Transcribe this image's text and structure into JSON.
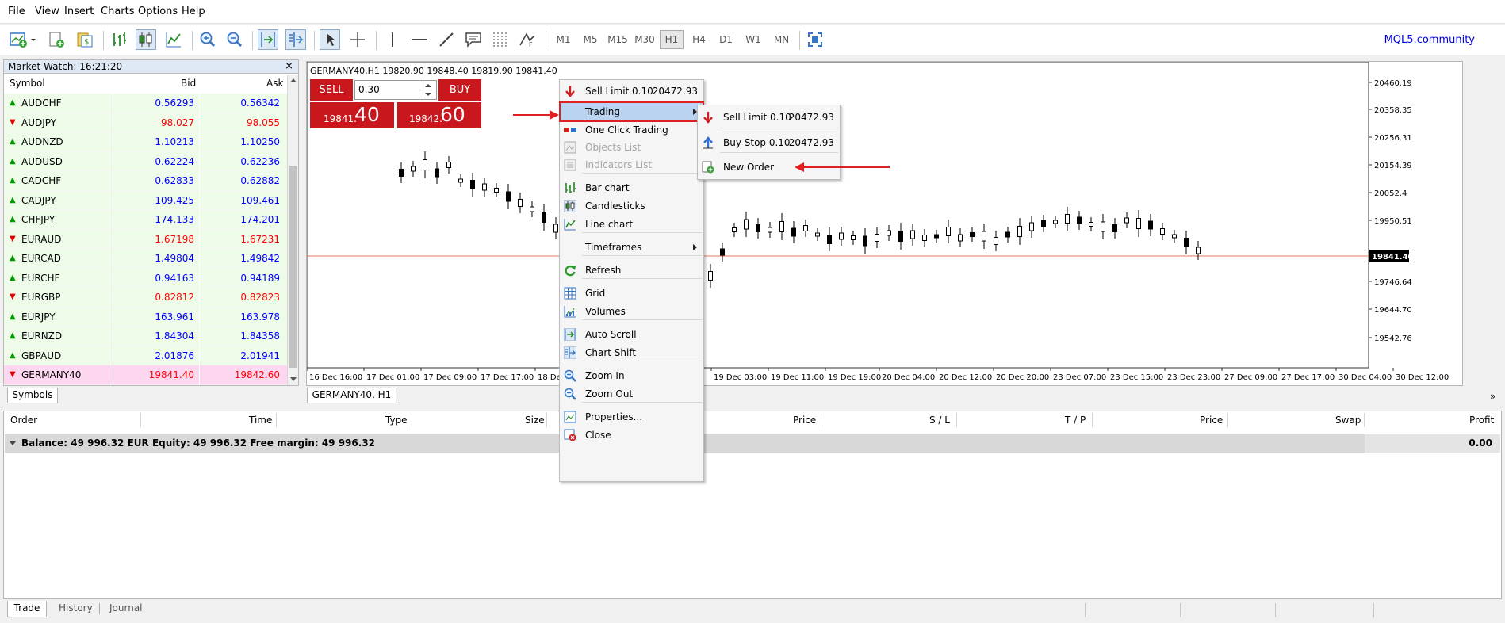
{
  "menubar": [
    "File",
    "View",
    "Insert",
    "Charts",
    "Options",
    "Help"
  ],
  "toolbar": {
    "timeframes": [
      "M1",
      "M5",
      "M15",
      "M30",
      "H1",
      "H4",
      "D1",
      "W1",
      "MN"
    ],
    "active_timeframe": "H1",
    "community_link": "MQL5.community"
  },
  "market_watch": {
    "title": "Market Watch: 16:21:20",
    "close": "×",
    "columns": [
      "Symbol",
      "Bid",
      "Ask"
    ],
    "rows": [
      {
        "symbol": "AUDCHF",
        "bid": "0.56293",
        "ask": "0.56342",
        "dir": "up"
      },
      {
        "symbol": "AUDJPY",
        "bid": "98.027",
        "ask": "98.055",
        "dir": "down"
      },
      {
        "symbol": "AUDNZD",
        "bid": "1.10213",
        "ask": "1.10250",
        "dir": "up"
      },
      {
        "symbol": "AUDUSD",
        "bid": "0.62224",
        "ask": "0.62236",
        "dir": "up"
      },
      {
        "symbol": "CADCHF",
        "bid": "0.62833",
        "ask": "0.62882",
        "dir": "up"
      },
      {
        "symbol": "CADJPY",
        "bid": "109.425",
        "ask": "109.461",
        "dir": "up"
      },
      {
        "symbol": "CHFJPY",
        "bid": "174.133",
        "ask": "174.201",
        "dir": "up"
      },
      {
        "symbol": "EURAUD",
        "bid": "1.67198",
        "ask": "1.67231",
        "dir": "down"
      },
      {
        "symbol": "EURCAD",
        "bid": "1.49804",
        "ask": "1.49842",
        "dir": "up"
      },
      {
        "symbol": "EURCHF",
        "bid": "0.94163",
        "ask": "0.94189",
        "dir": "up"
      },
      {
        "symbol": "EURGBP",
        "bid": "0.82812",
        "ask": "0.82823",
        "dir": "down"
      },
      {
        "symbol": "EURJPY",
        "bid": "163.961",
        "ask": "163.978",
        "dir": "up"
      },
      {
        "symbol": "EURNZD",
        "bid": "1.84304",
        "ask": "1.84358",
        "dir": "up"
      },
      {
        "symbol": "GBPAUD",
        "bid": "2.01876",
        "ask": "2.01941",
        "dir": "up"
      },
      {
        "symbol": "GERMANY40",
        "bid": "19841.40",
        "ask": "19842.60",
        "dir": "down"
      }
    ],
    "tab": "Symbols"
  },
  "chart": {
    "header": "GERMANY40,H1  19820.90 19848.40 19819.90 19841.40",
    "tab": "GERMANY40, H1",
    "one_click": {
      "sell_label": "SELL",
      "buy_label": "BUY",
      "volume": "0.30",
      "sell_price_small": "19841.",
      "sell_price_big": "40",
      "buy_price_small": "19842.",
      "buy_price_big": "60"
    },
    "price_axis": [
      "20460.19",
      "20358.35",
      "20256.31",
      "20154.39",
      "20052.4",
      "19950.51",
      "19841.40",
      "19746.64",
      "19644.70",
      "19542.76"
    ],
    "current_price": "19841.40",
    "time_axis": [
      "16 Dec 16:00",
      "17 Dec 01:00",
      "17 Dec 09:00",
      "17 Dec 17:00",
      "18 Dec",
      "19 Dec 03:00",
      "19 Dec 11:00",
      "19 Dec 19:00",
      "20 Dec 04:00",
      "20 Dec 12:00",
      "20 Dec 20:00",
      "23 Dec 07:00",
      "23 Dec 15:00",
      "23 Dec 23:00",
      "27 Dec 09:00",
      "27 Dec 17:00",
      "30 Dec 04:00",
      "30 Dec 12:00"
    ],
    "expand": "»"
  },
  "context_menu": {
    "items": [
      {
        "label": "Sell Limit 0.10",
        "value": "20472.93",
        "icon": "sell-arrow-icon"
      },
      {
        "label": "Trading",
        "submenu": true,
        "icon": "none"
      },
      {
        "label": "One Click Trading",
        "icon": "one-click-icon"
      },
      {
        "label": "Objects List",
        "disabled": true,
        "icon": "objects-icon"
      },
      {
        "label": "Indicators List",
        "disabled": true,
        "icon": "indicators-icon"
      },
      {
        "label": "Bar chart",
        "icon": "bar-chart-icon"
      },
      {
        "label": "Candlesticks",
        "icon": "candlesticks-icon"
      },
      {
        "label": "Line chart",
        "icon": "line-chart-icon"
      },
      {
        "label": "Timeframes",
        "submenu": true,
        "icon": "none"
      },
      {
        "label": "Refresh",
        "icon": "refresh-icon"
      },
      {
        "label": "Grid",
        "icon": "grid-icon"
      },
      {
        "label": "Volumes",
        "icon": "volumes-icon"
      },
      {
        "label": "Auto Scroll",
        "icon": "auto-scroll-icon"
      },
      {
        "label": "Chart Shift",
        "icon": "chart-shift-icon"
      },
      {
        "label": "Zoom In",
        "icon": "zoom-in-icon"
      },
      {
        "label": "Zoom Out",
        "icon": "zoom-out-icon"
      },
      {
        "label": "Properties...",
        "icon": "properties-icon"
      },
      {
        "label": "Close",
        "icon": "close-icon"
      }
    ]
  },
  "trading_submenu": {
    "items": [
      {
        "label": "Sell Limit 0.10",
        "value": "20472.93",
        "icon": "sell-arrow-icon"
      },
      {
        "label": "Buy Stop 0.10",
        "value": "20472.93",
        "icon": "buy-arrow-icon"
      },
      {
        "label": "New Order",
        "icon": "new-order-icon"
      }
    ]
  },
  "terminal": {
    "columns": [
      "Order",
      "Time",
      "Type",
      "Size",
      "Price",
      "S / L",
      "T / P",
      "Price",
      "Swap",
      "Profit"
    ],
    "balance_line": "Balance: 49 996.32 EUR  Equity: 49 996.32  Free margin: 49 996.32",
    "profit": "0.00",
    "tabs": [
      "Trade",
      "History",
      "Journal"
    ]
  },
  "colors": {
    "up": "#009900",
    "down": "#e00000",
    "bid_up": "#0000ff",
    "bid_down": "#ff0000",
    "highlight": "#fdd7f0",
    "accent_red": "#c8171d",
    "menu_highlight": "#b9d3f0",
    "annotation_arrow": "#e02020"
  }
}
